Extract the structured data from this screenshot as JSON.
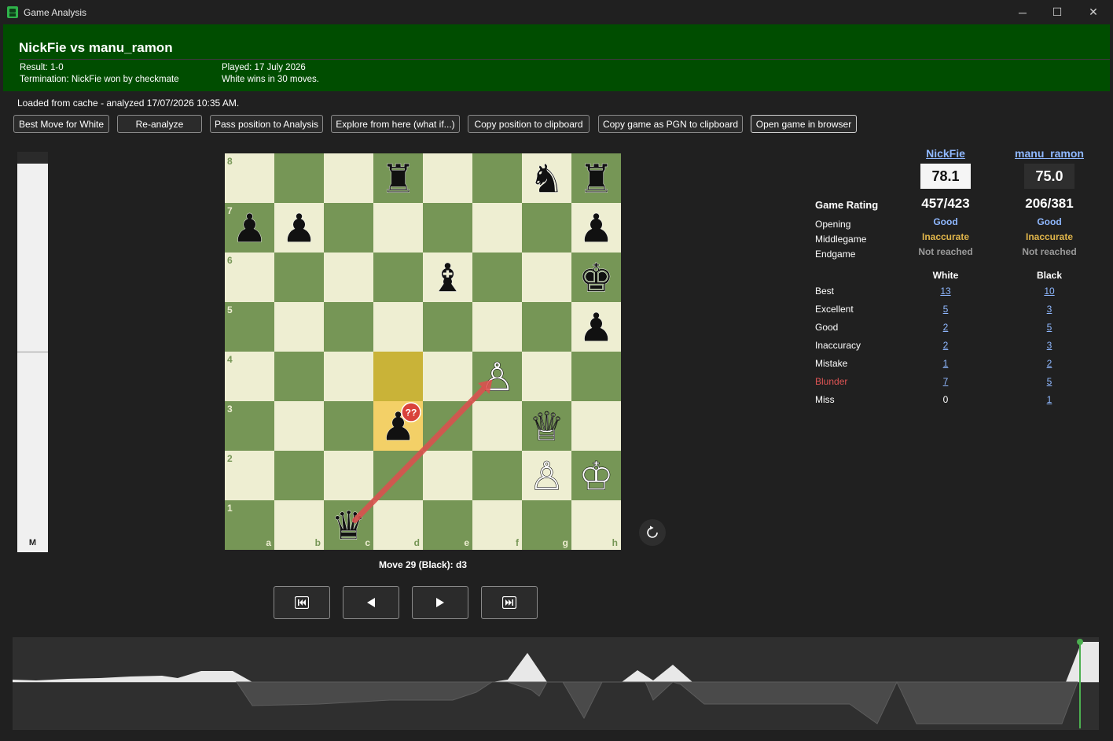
{
  "window": {
    "title": "Game Analysis",
    "minimize": "─",
    "maximize": "☐",
    "close": "✕"
  },
  "header": {
    "players": "NickFie vs manu_ramon",
    "result": "Result: 1-0",
    "termination": "Termination: NickFie won by checkmate",
    "played": "Played: 17 July 2026",
    "summary": "White wins in 30 moves."
  },
  "cache_status": "Loaded from cache - analyzed 17/07/2026 10:35 AM.",
  "toolbar": {
    "best_move": "Best Move for White",
    "reanalyze": "Re-analyze",
    "pass_position": "Pass position to Analysis",
    "explore": "Explore from here (what if...)",
    "copy_position": "Copy position to clipboard",
    "copy_pgn": "Copy game as PGN to clipboard",
    "open_browser": "Open game in browser"
  },
  "eval_bar": {
    "label": "M"
  },
  "board": {
    "files": [
      "a",
      "b",
      "c",
      "d",
      "e",
      "f",
      "g",
      "h"
    ],
    "ranks": [
      "8",
      "7",
      "6",
      "5",
      "4",
      "3",
      "2",
      "1"
    ],
    "colors": {
      "light": "#eeeed2",
      "dark": "#769656",
      "highlight_from": "#c9b338",
      "highlight_to": "#f3d067",
      "arrow": "#d9524f",
      "badge": "#d9423b"
    },
    "badge": "??",
    "pieces": [
      {
        "sq": "d8",
        "p": "r",
        "glyph": "♜"
      },
      {
        "sq": "g8",
        "p": "n",
        "glyph": "♞"
      },
      {
        "sq": "h8",
        "p": "r",
        "glyph": "♜"
      },
      {
        "sq": "a7",
        "p": "p",
        "glyph": "♟"
      },
      {
        "sq": "b7",
        "p": "p",
        "glyph": "♟"
      },
      {
        "sq": "h7",
        "p": "p",
        "glyph": "♟"
      },
      {
        "sq": "e6",
        "p": "b",
        "glyph": "♝"
      },
      {
        "sq": "h6",
        "p": "k",
        "glyph": "♚"
      },
      {
        "sq": "h5",
        "p": "p",
        "glyph": "♟"
      },
      {
        "sq": "f4",
        "p": "P",
        "glyph": "♙"
      },
      {
        "sq": "d3",
        "p": "p",
        "glyph": "♟"
      },
      {
        "sq": "g3",
        "p": "Q",
        "glyph": "♕"
      },
      {
        "sq": "g2",
        "p": "P",
        "glyph": "♙"
      },
      {
        "sq": "h2",
        "p": "K",
        "glyph": "♔"
      },
      {
        "sq": "c1",
        "p": "q",
        "glyph": "♛"
      }
    ],
    "highlight_from": "d4",
    "highlight_to": "d3",
    "arrow": {
      "from": "c1",
      "to": "f4"
    }
  },
  "move_caption": "Move 29 (Black): d3",
  "nav": {
    "first": "⏮",
    "prev": "◀",
    "next": "▶",
    "last": "⏭"
  },
  "flip_icon": "↺",
  "stats": {
    "white_player": "NickFie",
    "black_player": "manu_ramon",
    "white_score": "78.1",
    "black_score": "75.0",
    "game_rating_label": "Game Rating",
    "white_accuracy": "457/423",
    "black_accuracy": "206/381",
    "phases": [
      {
        "label": "Opening",
        "white": "Good",
        "black": "Good",
        "wcolor": "#8fb8ff",
        "bcolor": "#8fb8ff"
      },
      {
        "label": "Middlegame",
        "white": "Inaccurate",
        "black": "Inaccurate",
        "wcolor": "#e0b54a",
        "bcolor": "#e0b54a"
      },
      {
        "label": "Endgame",
        "white": "Not reached",
        "black": "Not reached",
        "wcolor": "#9a9a9a",
        "bcolor": "#9a9a9a"
      }
    ],
    "col_white": "White",
    "col_black": "Black",
    "classifications": [
      {
        "label": "Best",
        "white": "13",
        "black": "10"
      },
      {
        "label": "Excellent",
        "white": "5",
        "black": "3"
      },
      {
        "label": "Good",
        "white": "2",
        "black": "5"
      },
      {
        "label": "Inaccuracy",
        "white": "2",
        "black": "3"
      },
      {
        "label": "Mistake",
        "white": "1",
        "black": "2"
      },
      {
        "label": "Blunder",
        "white": "7",
        "black": "5",
        "color": "#e05555"
      },
      {
        "label": "Miss",
        "white": "0",
        "black": "1"
      }
    ]
  },
  "graph": {
    "white_fill": "#e8e8e8",
    "marker": "#4caf50"
  }
}
